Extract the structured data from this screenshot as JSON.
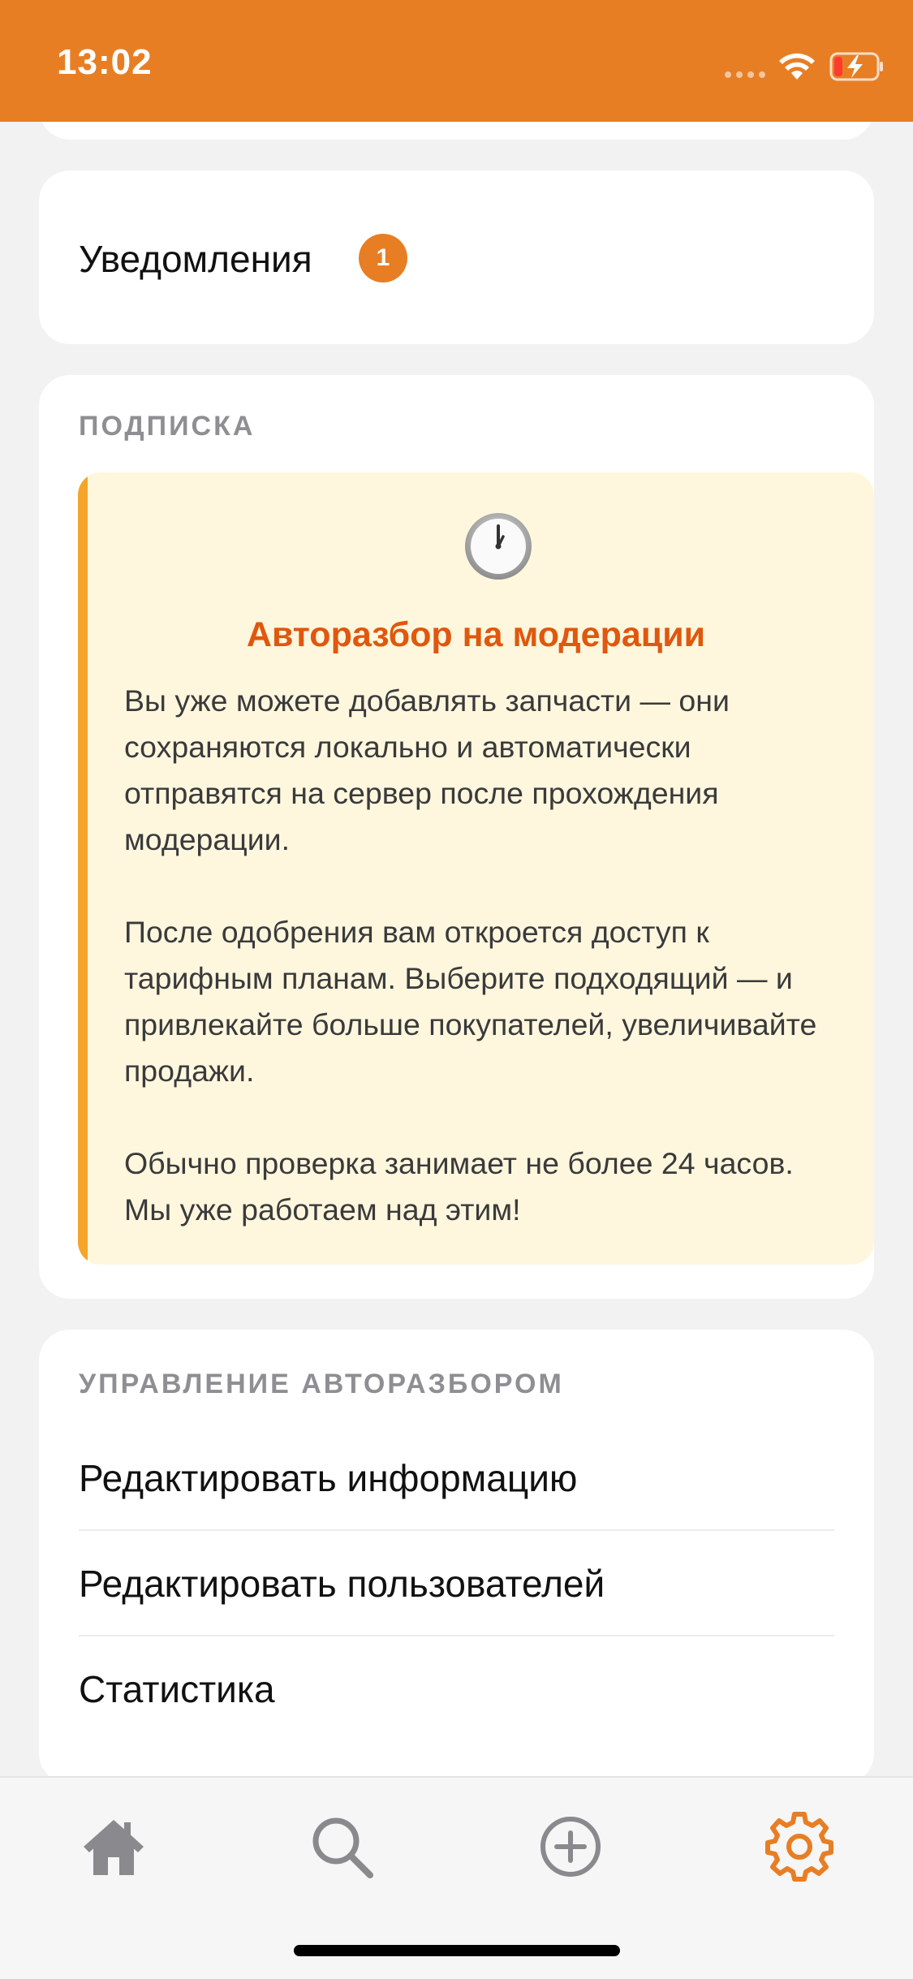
{
  "status_bar": {
    "time": "13:02",
    "background": "#e87e24"
  },
  "notifications": {
    "label": "Уведомления",
    "badge": "1"
  },
  "subscription": {
    "section_title": "ПОДПИСКА",
    "icon": "clock-icon",
    "heading": "Авторазбор на модерации",
    "paragraphs": [
      "Вы уже можете добавлять запчасти — они сохраняются локально и автоматически отправятся на сервер после прохождения модерации.",
      "После одобрения вам откроется доступ к тарифным планам. Выберите подходящий — и привлекайте больше покупателей, увеличивайте продажи.",
      "Обычно проверка занимает не более 24 часов. Мы уже работаем над этим!"
    ],
    "heading_color": "#e0570f",
    "box_color": "#fff7dd",
    "accent_color": "#f4a52a"
  },
  "management": {
    "section_title": "УПРАВЛЕНИЕ АВТОРАЗБОРОМ",
    "items": [
      "Редактировать информацию",
      "Редактировать пользователей",
      "Статистика"
    ]
  },
  "tab_bar": {
    "tabs": [
      {
        "icon": "home-icon",
        "active": false
      },
      {
        "icon": "search-icon",
        "active": false
      },
      {
        "icon": "add-circle-icon",
        "active": false
      },
      {
        "icon": "gear-icon",
        "active": true
      }
    ],
    "inactive_color": "#8a8a8e",
    "active_color": "#e87e24"
  }
}
